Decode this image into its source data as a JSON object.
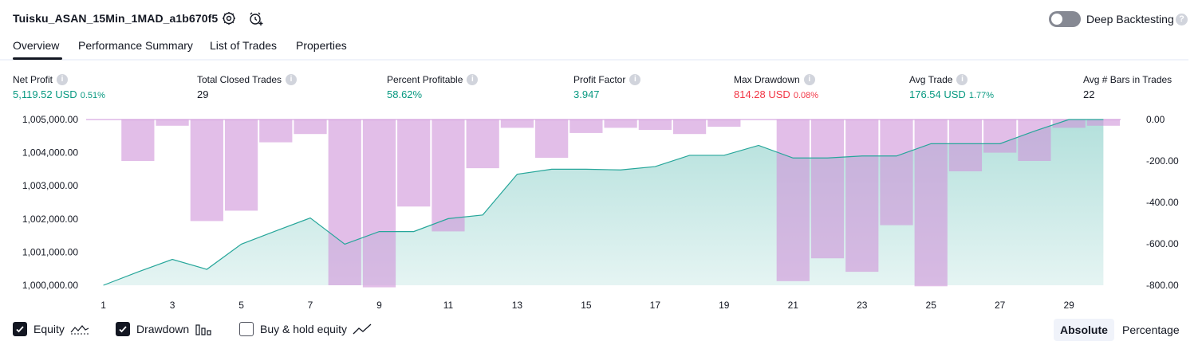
{
  "header": {
    "strategy_title": "Tuisku_ASAN_15Min_1MAD_a1b670f5",
    "deep_backtesting_label": "Deep Backtesting",
    "deep_backtesting_enabled": false,
    "help_glyph": "?"
  },
  "tabs": [
    {
      "label": "Overview",
      "active": true
    },
    {
      "label": "Performance Summary",
      "active": false
    },
    {
      "label": "List of Trades",
      "active": false
    },
    {
      "label": "Properties",
      "active": false
    }
  ],
  "metrics": [
    {
      "label": "Net Profit",
      "value": "5,119.52 USD",
      "sub": "0.51%",
      "tone": "green"
    },
    {
      "label": "Total Closed Trades",
      "value": "29",
      "sub": "",
      "tone": "dark"
    },
    {
      "label": "Percent Profitable",
      "value": "58.62%",
      "sub": "",
      "tone": "green"
    },
    {
      "label": "Profit Factor",
      "value": "3.947",
      "sub": "",
      "tone": "green"
    },
    {
      "label": "Max Drawdown",
      "value": "814.28 USD",
      "sub": "0.08%",
      "tone": "red"
    },
    {
      "label": "Avg Trade",
      "value": "176.54 USD",
      "sub": "1.77%",
      "tone": "green"
    },
    {
      "label": "Avg # Bars in Trades",
      "value": "22",
      "sub": "",
      "tone": "dark"
    }
  ],
  "info_glyph": "i",
  "chart_data": {
    "type": "line",
    "x_tick_labels": [
      "1",
      "3",
      "5",
      "7",
      "9",
      "11",
      "13",
      "15",
      "17",
      "19",
      "21",
      "23",
      "25",
      "27",
      "29"
    ],
    "left_axis": {
      "tick_labels": [
        "1,005,000.00",
        "1,004,000.00",
        "1,003,000.00",
        "1,002,000.00",
        "1,001,000.00",
        "1,000,000.00"
      ],
      "tick_values": [
        1005000,
        1004000,
        1003000,
        1002000,
        1001000,
        1000000
      ],
      "range": [
        1000000,
        1005000
      ]
    },
    "right_axis": {
      "tick_labels": [
        "0.00",
        "-200.00",
        "-400.00",
        "-600.00",
        "-800.00"
      ],
      "tick_values": [
        0,
        -200,
        -400,
        -600,
        -800
      ],
      "range": [
        -800,
        0
      ]
    },
    "trades": [
      1,
      2,
      3,
      4,
      5,
      6,
      7,
      8,
      9,
      10,
      11,
      12,
      13,
      14,
      15,
      16,
      17,
      18,
      19,
      20,
      21,
      22,
      23,
      24,
      25,
      26,
      27,
      28,
      29,
      30
    ],
    "series": [
      {
        "name": "Equity",
        "type": "area",
        "color": "#26a69a",
        "values": [
          1000000,
          1000400,
          1000780,
          1000480,
          1001240,
          1001640,
          1002030,
          1001240,
          1001620,
          1001620,
          1002010,
          1002120,
          1003350,
          1003500,
          1003500,
          1003480,
          1003580,
          1003920,
          1003920,
          1004220,
          1003840,
          1003840,
          1003900,
          1003900,
          1004270,
          1004270,
          1004270,
          1004650,
          1005000,
          1005000
        ]
      },
      {
        "name": "Drawdown",
        "type": "bar",
        "color": "#ce93d8",
        "values": [
          0,
          -200,
          -30,
          -490,
          -440,
          -110,
          -70,
          -800,
          -810,
          -420,
          -540,
          -235,
          -40,
          -185,
          -65,
          -40,
          -50,
          -70,
          -35,
          0,
          -780,
          -670,
          -735,
          -510,
          -805,
          -250,
          -160,
          -200,
          -40,
          -30
        ]
      }
    ],
    "grid": false,
    "legend_placement": "bottom-left"
  },
  "legend": [
    {
      "label": "Equity",
      "checked": true
    },
    {
      "label": "Drawdown",
      "checked": true
    },
    {
      "label": "Buy & hold equity",
      "checked": false
    }
  ],
  "view_modes": [
    {
      "label": "Absolute",
      "active": true
    },
    {
      "label": "Percentage",
      "active": false
    }
  ]
}
